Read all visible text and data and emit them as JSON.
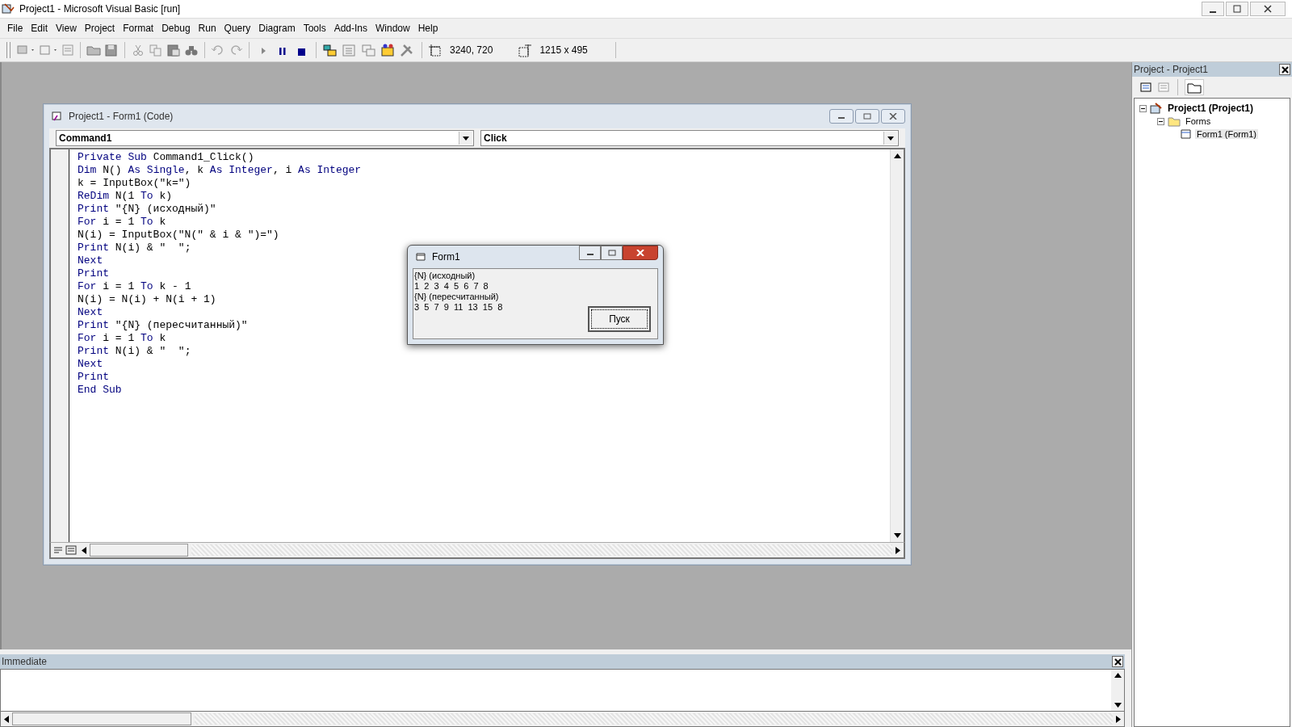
{
  "window": {
    "title": "Project1 - Microsoft Visual Basic [run]"
  },
  "menu": [
    {
      "label": "File"
    },
    {
      "label": "Edit"
    },
    {
      "label": "View"
    },
    {
      "label": "Project"
    },
    {
      "label": "Format"
    },
    {
      "label": "Debug"
    },
    {
      "label": "Run"
    },
    {
      "label": "Query"
    },
    {
      "label": "Diagram"
    },
    {
      "label": "Tools"
    },
    {
      "label": "Add-Ins"
    },
    {
      "label": "Window"
    },
    {
      "label": "Help"
    }
  ],
  "toolbar": {
    "position": "3240, 720",
    "size": "1215 x 495"
  },
  "code_window": {
    "title": "Project1 - Form1 (Code)",
    "object": "Command1",
    "procedure": "Click",
    "lines": [
      [
        {
          "kind": "keyword",
          "text": "Private Sub"
        },
        {
          "kind": "plain",
          "text": " Command1_Click()"
        }
      ],
      [
        {
          "kind": "keyword",
          "text": "Dim"
        },
        {
          "kind": "plain",
          "text": " N() "
        },
        {
          "kind": "keyword",
          "text": "As Single"
        },
        {
          "kind": "plain",
          "text": ", k "
        },
        {
          "kind": "keyword",
          "text": "As Integer"
        },
        {
          "kind": "plain",
          "text": ", i "
        },
        {
          "kind": "keyword",
          "text": "As Integer"
        }
      ],
      [
        {
          "kind": "plain",
          "text": "k = InputBox(\"k=\")"
        }
      ],
      [
        {
          "kind": "keyword",
          "text": "ReDim"
        },
        {
          "kind": "plain",
          "text": " N(1 "
        },
        {
          "kind": "keyword",
          "text": "To"
        },
        {
          "kind": "plain",
          "text": " k)"
        }
      ],
      [
        {
          "kind": "keyword",
          "text": "Print"
        },
        {
          "kind": "plain",
          "text": " \"{N} (исходный)\""
        }
      ],
      [
        {
          "kind": "keyword",
          "text": "For"
        },
        {
          "kind": "plain",
          "text": " i = 1 "
        },
        {
          "kind": "keyword",
          "text": "To"
        },
        {
          "kind": "plain",
          "text": " k"
        }
      ],
      [
        {
          "kind": "plain",
          "text": "N(i) = InputBox(\"N(\" & i & \")=\")"
        }
      ],
      [
        {
          "kind": "keyword",
          "text": "Print"
        },
        {
          "kind": "plain",
          "text": " N(i) & \"  \";"
        }
      ],
      [
        {
          "kind": "keyword",
          "text": "Next"
        }
      ],
      [
        {
          "kind": "keyword",
          "text": "Print"
        }
      ],
      [
        {
          "kind": "keyword",
          "text": "For"
        },
        {
          "kind": "plain",
          "text": " i = 1 "
        },
        {
          "kind": "keyword",
          "text": "To"
        },
        {
          "kind": "plain",
          "text": " k - 1"
        }
      ],
      [
        {
          "kind": "plain",
          "text": "N(i) = N(i) + N(i + 1)"
        }
      ],
      [
        {
          "kind": "keyword",
          "text": "Next"
        }
      ],
      [
        {
          "kind": "keyword",
          "text": "Print"
        },
        {
          "kind": "plain",
          "text": " \"{N} (пересчитанный)\""
        }
      ],
      [
        {
          "kind": "keyword",
          "text": "For"
        },
        {
          "kind": "plain",
          "text": " i = 1 "
        },
        {
          "kind": "keyword",
          "text": "To"
        },
        {
          "kind": "plain",
          "text": " k"
        }
      ],
      [
        {
          "kind": "keyword",
          "text": "Print"
        },
        {
          "kind": "plain",
          "text": " N(i) & \"  \";"
        }
      ],
      [
        {
          "kind": "keyword",
          "text": "Next"
        }
      ],
      [
        {
          "kind": "keyword",
          "text": "Print"
        }
      ],
      [
        {
          "kind": "keyword",
          "text": "End Sub"
        }
      ]
    ]
  },
  "form_window": {
    "title": "Form1",
    "output": [
      "{N} (исходный)",
      "1  2  3  4  5  6  7  8",
      "{N} (пересчитанный)",
      "3  5  7  9  11  13  15  8"
    ],
    "button": "Пуск"
  },
  "project_panel": {
    "title": "Project - Project1",
    "tree": [
      {
        "label": "Project1 (Project1)",
        "expanded": true,
        "selected": false,
        "children": [
          {
            "label": "Forms",
            "expanded": true,
            "selected": false,
            "children": [
              {
                "label": "Form1 (Form1)",
                "selected": true
              }
            ]
          }
        ]
      }
    ]
  },
  "immediate": {
    "title": "Immediate"
  }
}
